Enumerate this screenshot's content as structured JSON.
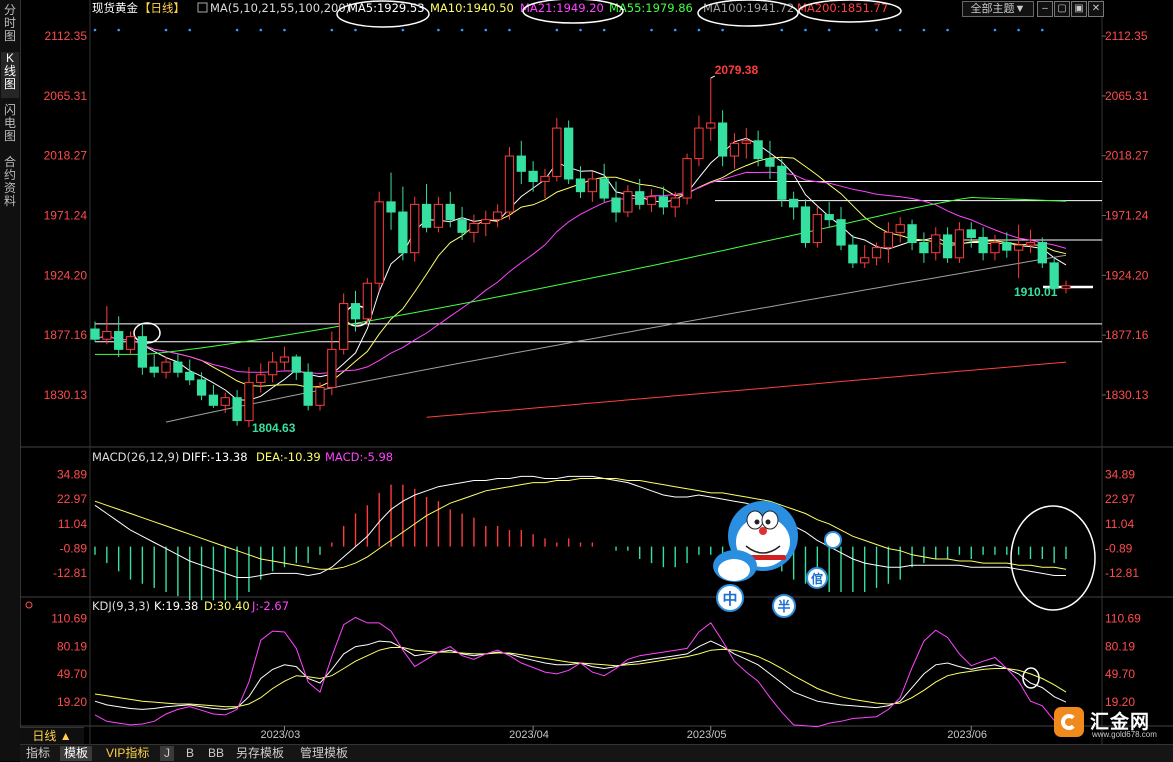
{
  "sidebar": {
    "tabs": [
      {
        "label": "分时图"
      },
      {
        "label": "K线图"
      },
      {
        "label": "闪电图"
      },
      {
        "label": "合约资料"
      }
    ]
  },
  "header": {
    "instrument": "现货黄金",
    "period_tag": "【日线】",
    "ma_params": "MA(5,10,21,55,100,200)",
    "ma_values": [
      {
        "label": "MA5:1929.53",
        "color": "#ffffff"
      },
      {
        "label": "MA10:1940.50",
        "color": "#ffff66"
      },
      {
        "label": "MA21:1949.20",
        "color": "#ff44ff"
      },
      {
        "label": "MA55:1979.86",
        "color": "#44ff44"
      },
      {
        "label": "MA100:1941.72",
        "color": "#a0a0a0"
      },
      {
        "label": "MA200:1851.77",
        "color": "#ff4040"
      }
    ],
    "theme_button": "全部主题▼"
  },
  "colors": {
    "up": "#ff3c3c",
    "down": "#36e0a0",
    "axis_red": "#ff4c4c",
    "bg": "#000000",
    "grid": "#2a2a2a"
  },
  "chart_data": [
    {
      "type": "candlestick",
      "title": "现货黄金 日线",
      "y_ticks": [
        "2112.35",
        "2065.31",
        "2018.27",
        "1971.24",
        "1924.20",
        "1877.16",
        "1830.13"
      ],
      "ylim": [
        1790,
        2125
      ],
      "x_ticks": [
        "2023/03",
        "2023/04",
        "2023/05",
        "2023/06"
      ],
      "annotations": {
        "high_label": "2079.38",
        "low_label": "1804.63",
        "last_low_label": "1910.01"
      },
      "horizontal_levels": [
        1998,
        1983,
        1952,
        1915,
        1886,
        1872
      ],
      "candles": [
        {
          "o": 1882,
          "h": 1888,
          "l": 1872,
          "c": 1874
        },
        {
          "o": 1874,
          "h": 1900,
          "l": 1870,
          "c": 1880
        },
        {
          "o": 1880,
          "h": 1892,
          "l": 1860,
          "c": 1866
        },
        {
          "o": 1866,
          "h": 1880,
          "l": 1862,
          "c": 1876
        },
        {
          "o": 1876,
          "h": 1886,
          "l": 1846,
          "c": 1852
        },
        {
          "o": 1852,
          "h": 1862,
          "l": 1844,
          "c": 1848
        },
        {
          "o": 1848,
          "h": 1860,
          "l": 1843,
          "c": 1856
        },
        {
          "o": 1856,
          "h": 1862,
          "l": 1844,
          "c": 1848
        },
        {
          "o": 1848,
          "h": 1858,
          "l": 1838,
          "c": 1842
        },
        {
          "o": 1842,
          "h": 1848,
          "l": 1826,
          "c": 1830
        },
        {
          "o": 1830,
          "h": 1838,
          "l": 1820,
          "c": 1822
        },
        {
          "o": 1822,
          "h": 1832,
          "l": 1816,
          "c": 1828
        },
        {
          "o": 1828,
          "h": 1834,
          "l": 1806,
          "c": 1810
        },
        {
          "o": 1810,
          "h": 1852,
          "l": 1805,
          "c": 1840
        },
        {
          "o": 1840,
          "h": 1855,
          "l": 1832,
          "c": 1846
        },
        {
          "o": 1846,
          "h": 1864,
          "l": 1840,
          "c": 1856
        },
        {
          "o": 1856,
          "h": 1868,
          "l": 1850,
          "c": 1860
        },
        {
          "o": 1860,
          "h": 1862,
          "l": 1842,
          "c": 1848
        },
        {
          "o": 1848,
          "h": 1855,
          "l": 1818,
          "c": 1822
        },
        {
          "o": 1822,
          "h": 1840,
          "l": 1818,
          "c": 1836
        },
        {
          "o": 1836,
          "h": 1880,
          "l": 1830,
          "c": 1866
        },
        {
          "o": 1866,
          "h": 1910,
          "l": 1862,
          "c": 1902
        },
        {
          "o": 1902,
          "h": 1912,
          "l": 1880,
          "c": 1890
        },
        {
          "o": 1890,
          "h": 1922,
          "l": 1886,
          "c": 1918
        },
        {
          "o": 1918,
          "h": 1990,
          "l": 1912,
          "c": 1982
        },
        {
          "o": 1982,
          "h": 2005,
          "l": 1960,
          "c": 1974
        },
        {
          "o": 1974,
          "h": 1994,
          "l": 1936,
          "c": 1942
        },
        {
          "o": 1942,
          "h": 1986,
          "l": 1935,
          "c": 1980
        },
        {
          "o": 1980,
          "h": 1996,
          "l": 1958,
          "c": 1962
        },
        {
          "o": 1962,
          "h": 1986,
          "l": 1958,
          "c": 1980
        },
        {
          "o": 1980,
          "h": 1990,
          "l": 1962,
          "c": 1968
        },
        {
          "o": 1968,
          "h": 1978,
          "l": 1952,
          "c": 1958
        },
        {
          "o": 1958,
          "h": 1972,
          "l": 1950,
          "c": 1965
        },
        {
          "o": 1965,
          "h": 1975,
          "l": 1955,
          "c": 1968
        },
        {
          "o": 1968,
          "h": 1980,
          "l": 1962,
          "c": 1974
        },
        {
          "o": 1974,
          "h": 2025,
          "l": 1968,
          "c": 2018
        },
        {
          "o": 2018,
          "h": 2030,
          "l": 1996,
          "c": 2006
        },
        {
          "o": 2006,
          "h": 2014,
          "l": 1990,
          "c": 1998
        },
        {
          "o": 1998,
          "h": 2008,
          "l": 1985,
          "c": 2002
        },
        {
          "o": 2002,
          "h": 2048,
          "l": 1998,
          "c": 2040
        },
        {
          "o": 2040,
          "h": 2046,
          "l": 1996,
          "c": 2000
        },
        {
          "o": 2000,
          "h": 2010,
          "l": 1985,
          "c": 1990
        },
        {
          "o": 1990,
          "h": 2006,
          "l": 1982,
          "c": 2000
        },
        {
          "o": 2000,
          "h": 2012,
          "l": 1982,
          "c": 1985
        },
        {
          "o": 1985,
          "h": 1998,
          "l": 1966,
          "c": 1974
        },
        {
          "o": 1974,
          "h": 1995,
          "l": 1970,
          "c": 1990
        },
        {
          "o": 1990,
          "h": 2000,
          "l": 1976,
          "c": 1980
        },
        {
          "o": 1980,
          "h": 1992,
          "l": 1974,
          "c": 1986
        },
        {
          "o": 1986,
          "h": 1994,
          "l": 1972,
          "c": 1978
        },
        {
          "o": 1978,
          "h": 1990,
          "l": 1970,
          "c": 1985
        },
        {
          "o": 1985,
          "h": 2020,
          "l": 1980,
          "c": 2016
        },
        {
          "o": 2016,
          "h": 2050,
          "l": 2010,
          "c": 2040
        },
        {
          "o": 2040,
          "h": 2079.38,
          "l": 2030,
          "c": 2044
        },
        {
          "o": 2044,
          "h": 2054,
          "l": 2010,
          "c": 2018
        },
        {
          "o": 2018,
          "h": 2036,
          "l": 2008,
          "c": 2028
        },
        {
          "o": 2028,
          "h": 2040,
          "l": 2016,
          "c": 2030
        },
        {
          "o": 2030,
          "h": 2038,
          "l": 2010,
          "c": 2016
        },
        {
          "o": 2016,
          "h": 2030,
          "l": 2000,
          "c": 2010
        },
        {
          "o": 2010,
          "h": 2016,
          "l": 1978,
          "c": 1984
        },
        {
          "o": 1984,
          "h": 1990,
          "l": 1968,
          "c": 1978
        },
        {
          "o": 1978,
          "h": 1984,
          "l": 1946,
          "c": 1950
        },
        {
          "o": 1950,
          "h": 1978,
          "l": 1946,
          "c": 1972
        },
        {
          "o": 1972,
          "h": 1982,
          "l": 1962,
          "c": 1968
        },
        {
          "o": 1968,
          "h": 1978,
          "l": 1944,
          "c": 1948
        },
        {
          "o": 1948,
          "h": 1956,
          "l": 1930,
          "c": 1934
        },
        {
          "o": 1934,
          "h": 1948,
          "l": 1930,
          "c": 1938
        },
        {
          "o": 1938,
          "h": 1950,
          "l": 1932,
          "c": 1946
        },
        {
          "o": 1946,
          "h": 1966,
          "l": 1934,
          "c": 1958
        },
        {
          "o": 1958,
          "h": 1970,
          "l": 1950,
          "c": 1964
        },
        {
          "o": 1964,
          "h": 1968,
          "l": 1944,
          "c": 1950
        },
        {
          "o": 1950,
          "h": 1958,
          "l": 1934,
          "c": 1942
        },
        {
          "o": 1942,
          "h": 1962,
          "l": 1936,
          "c": 1956
        },
        {
          "o": 1956,
          "h": 1962,
          "l": 1934,
          "c": 1938
        },
        {
          "o": 1938,
          "h": 1966,
          "l": 1934,
          "c": 1960
        },
        {
          "o": 1960,
          "h": 1966,
          "l": 1946,
          "c": 1954
        },
        {
          "o": 1954,
          "h": 1962,
          "l": 1936,
          "c": 1942
        },
        {
          "o": 1942,
          "h": 1956,
          "l": 1936,
          "c": 1950
        },
        {
          "o": 1950,
          "h": 1958,
          "l": 1938,
          "c": 1944
        },
        {
          "o": 1944,
          "h": 1964,
          "l": 1922,
          "c": 1948
        },
        {
          "o": 1948,
          "h": 1960,
          "l": 1942,
          "c": 1950
        },
        {
          "o": 1950,
          "h": 1954,
          "l": 1930,
          "c": 1934
        },
        {
          "o": 1934,
          "h": 1938,
          "l": 1910.01,
          "c": 1914
        },
        {
          "o": 1914,
          "h": 1920,
          "l": 1910,
          "c": 1916
        }
      ],
      "ma_lines": [
        {
          "name": "MA5",
          "color": "#ffffff"
        },
        {
          "name": "MA10",
          "color": "#ffff66"
        },
        {
          "name": "MA21",
          "color": "#ff44ff"
        },
        {
          "name": "MA55",
          "color": "#44ff44"
        },
        {
          "name": "MA100",
          "color": "#a0a0a0"
        },
        {
          "name": "MA200",
          "color": "#ff4040"
        }
      ]
    },
    {
      "type": "macd",
      "header": {
        "title": "MACD(26,12,9)",
        "diff": "DIFF:-13.38",
        "dea": "DEA:-10.39",
        "macd": "MACD:-5.98"
      },
      "y_ticks": [
        "34.89",
        "22.97",
        "11.04",
        "-0.89",
        "-12.81"
      ],
      "ylim": [
        -22,
        40
      ],
      "diff": [
        20,
        16,
        12,
        8,
        5,
        2,
        -1,
        -4,
        -7,
        -9,
        -11,
        -13,
        -15,
        -15,
        -14,
        -13,
        -13,
        -13,
        -14,
        -13,
        -10,
        -5,
        0,
        5,
        12,
        18,
        22,
        25,
        27,
        29,
        30,
        31,
        32,
        32,
        33,
        33,
        34,
        34,
        33,
        33,
        34,
        34,
        34,
        33,
        32,
        31,
        29,
        27,
        25,
        24,
        24,
        25,
        24,
        23,
        22,
        21,
        19,
        17,
        14,
        10,
        7,
        3,
        0,
        -3,
        -6,
        -8,
        -9,
        -10,
        -10,
        -9,
        -9,
        -9,
        -9,
        -9,
        -10,
        -10,
        -10,
        -10,
        -11,
        -12,
        -13,
        -14,
        -14
      ],
      "dea": [
        22,
        20,
        18,
        16,
        14,
        12,
        10,
        8,
        6,
        4,
        2,
        0,
        -2,
        -4,
        -6,
        -7,
        -8,
        -9,
        -10,
        -11,
        -11,
        -10,
        -8,
        -5,
        -1,
        3,
        7,
        11,
        15,
        18,
        21,
        23,
        25,
        27,
        28,
        29,
        30,
        31,
        31,
        32,
        32,
        33,
        33,
        33,
        33,
        32,
        32,
        31,
        30,
        29,
        28,
        27,
        26,
        26,
        25,
        24,
        23,
        22,
        20,
        18,
        16,
        13,
        11,
        8,
        5,
        3,
        1,
        -1,
        -2,
        -4,
        -5,
        -6,
        -6,
        -7,
        -7,
        -8,
        -8,
        -8,
        -9,
        -9,
        -10,
        -10,
        -11
      ]
    },
    {
      "type": "kdj",
      "header": {
        "title": "KDJ(9,3,3)",
        "k": "K:19.38",
        "d": "D:30.40",
        "j": "J:-2.67"
      },
      "y_ticks": [
        "110.69",
        "80.19",
        "49.70",
        "19.20"
      ],
      "ylim": [
        -5,
        118
      ],
      "k": [
        20,
        16,
        14,
        12,
        11,
        12,
        14,
        15,
        16,
        14,
        12,
        11,
        13,
        25,
        45,
        55,
        60,
        58,
        45,
        40,
        55,
        72,
        80,
        82,
        86,
        85,
        78,
        70,
        72,
        74,
        76,
        72,
        70,
        72,
        74,
        72,
        68,
        65,
        62,
        60,
        60,
        62,
        58,
        56,
        58,
        62,
        64,
        66,
        68,
        70,
        72,
        80,
        86,
        80,
        72,
        66,
        60,
        50,
        40,
        30,
        25,
        20,
        18,
        16,
        15,
        14,
        13,
        15,
        20,
        35,
        50,
        60,
        62,
        58,
        55,
        58,
        60,
        56,
        50,
        40,
        35,
        25,
        19
      ],
      "d": [
        28,
        26,
        24,
        22,
        20,
        19,
        18,
        17,
        17,
        16,
        15,
        14,
        14,
        17,
        24,
        34,
        42,
        48,
        47,
        45,
        48,
        56,
        64,
        70,
        76,
        79,
        79,
        76,
        75,
        74,
        74,
        73,
        72,
        72,
        73,
        73,
        71,
        69,
        67,
        65,
        63,
        62,
        61,
        60,
        59,
        60,
        61,
        63,
        65,
        67,
        69,
        72,
        76,
        77,
        76,
        73,
        69,
        63,
        56,
        48,
        41,
        34,
        29,
        25,
        22,
        20,
        18,
        17,
        18,
        24,
        32,
        41,
        48,
        51,
        53,
        55,
        56,
        56,
        54,
        50,
        45,
        38,
        30
      ],
      "j": [
        5,
        -2,
        -4,
        -6,
        -5,
        -2,
        6,
        11,
        14,
        10,
        6,
        5,
        11,
        41,
        87,
        97,
        96,
        78,
        41,
        30,
        69,
        104,
        112,
        106,
        106,
        97,
        76,
        58,
        66,
        74,
        80,
        70,
        66,
        72,
        76,
        70,
        62,
        57,
        52,
        50,
        54,
        62,
        52,
        48,
        56,
        66,
        70,
        72,
        74,
        76,
        78,
        96,
        106,
        86,
        64,
        52,
        42,
        24,
        8,
        -6,
        -7,
        -8,
        -4,
        -2,
        1,
        2,
        3,
        11,
        24,
        57,
        86,
        98,
        90,
        72,
        59,
        64,
        68,
        56,
        42,
        20,
        15,
        -1,
        -3
      ]
    }
  ],
  "footer": {
    "period_button": "日线 ▲",
    "tabs": [
      "指标",
      "模板",
      "VIP指标",
      "J",
      "B",
      "BB",
      "另存模板",
      "管理模板"
    ],
    "selected_tab": "模板"
  },
  "logo": {
    "text": "汇金网",
    "url": "www.gold678.com"
  },
  "mascot_chars": [
    "中",
    "半",
    "倌"
  ]
}
